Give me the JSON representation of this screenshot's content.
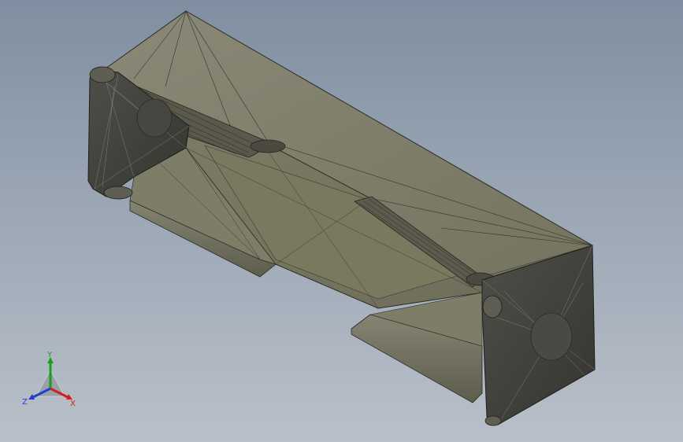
{
  "viewport": {
    "background_top": "#7f8fa1",
    "background_bottom": "#b9c0c9",
    "model_fill": "#6e6d63",
    "model_edge": "#2a2a25"
  },
  "triad": {
    "x_label": "X",
    "y_label": "Y",
    "z_label": "Z",
    "x_color": "#d22020",
    "y_color": "#18a018",
    "z_color": "#2040d0"
  }
}
